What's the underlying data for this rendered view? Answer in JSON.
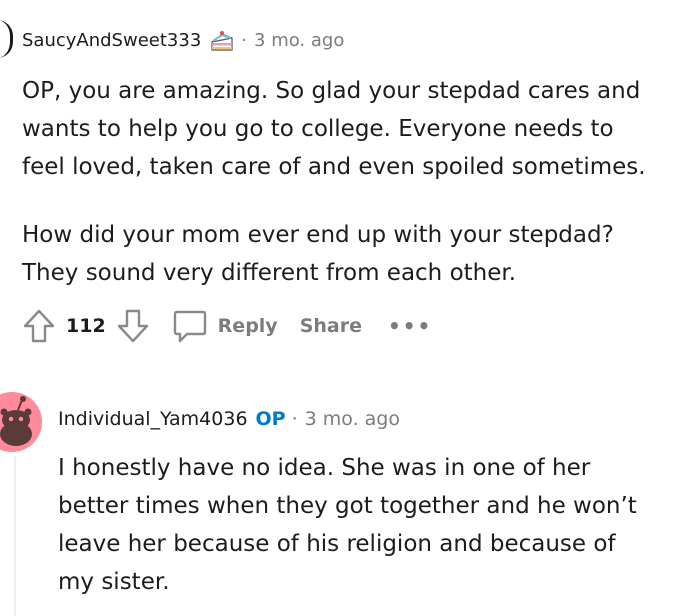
{
  "comment1": {
    "username": "SaucyAndSweet333",
    "time": "3 mo. ago",
    "paragraphs": [
      "OP, you are amazing. So glad your stepdad cares and\nwants to help you go to college. Everyone needs to\nfeel loved, taken care of and even spoiled sometimes.",
      "How did your mom ever end up with your stepdad?\nThey sound very different from each other."
    ],
    "votes": "112",
    "reply_label": "Reply",
    "share_label": "Share",
    "more_label": "•••"
  },
  "comment2": {
    "username": "Individual_Yam4036",
    "op_label": "OP",
    "time": "3 mo. ago",
    "text": "I honestly have no idea. She was in one of her\nbetter times when they got together and he won’t\nleave her because of his religion and because of\nmy sister."
  },
  "meta_separator": "·",
  "colors": {
    "text": "#1c1c1c",
    "meta": "#7c7c7c",
    "op_badge": "#0079d3",
    "avatar_bg": "#ff8a9b",
    "thread_line": "#edeff1"
  },
  "icons": [
    "cake-flair-icon",
    "upvote-icon",
    "downvote-icon",
    "comment-bubble-icon",
    "snoo-avatar-icon"
  ]
}
